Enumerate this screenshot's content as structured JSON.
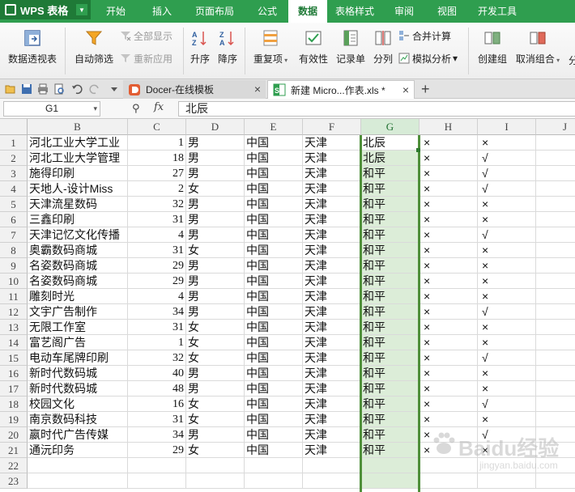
{
  "app": {
    "title": "WPS 表格"
  },
  "menu_tabs": [
    {
      "label": "开始",
      "active": false
    },
    {
      "label": "插入",
      "active": false
    },
    {
      "label": "页面布局",
      "active": false
    },
    {
      "label": "公式",
      "active": false
    },
    {
      "label": "数据",
      "active": true
    },
    {
      "label": "表格样式",
      "active": false
    },
    {
      "label": "审阅",
      "active": false
    },
    {
      "label": "视图",
      "active": false
    },
    {
      "label": "开发工具",
      "active": false
    }
  ],
  "ribbon": {
    "pivot": "数据透视表",
    "autofilter": "自动筛选",
    "show_all": "全部显示",
    "reapply": "重新应用",
    "sort_asc": "升序",
    "sort_desc": "降序",
    "duplicates": "重复项",
    "validity": "有效性",
    "record_form": "记录单",
    "split_column": "分列",
    "consolidate": "合并计算",
    "whatif": "模拟分析",
    "group": "创建组",
    "ungroup": "取消组合",
    "subtotal_partial": "分"
  },
  "doc_tabs": [
    {
      "label": "Docer-在线模板",
      "active": false
    },
    {
      "label": "新建 Micro...作表.xls *",
      "active": true
    }
  ],
  "formula_bar": {
    "name_box": "G1",
    "fx": "fx",
    "content": "北辰"
  },
  "columns": [
    "B",
    "C",
    "D",
    "E",
    "F",
    "G",
    "H",
    "I",
    "J"
  ],
  "selected_column": "G",
  "rows": [
    {
      "n": "1",
      "b": "河北工业大学工业",
      "c": "1",
      "d": "男",
      "e": "中国",
      "f": "天津",
      "g": "北辰",
      "h": "×",
      "i": "×"
    },
    {
      "n": "2",
      "b": "河北工业大学管理",
      "c": "18",
      "d": "男",
      "e": "中国",
      "f": "天津",
      "g": "北辰",
      "h": "×",
      "i": "√"
    },
    {
      "n": "3",
      "b": "施得印刷",
      "c": "27",
      "d": "男",
      "e": "中国",
      "f": "天津",
      "g": "和平",
      "h": "×",
      "i": "√"
    },
    {
      "n": "4",
      "b": "天地人-设计Miss",
      "c": "2",
      "d": "女",
      "e": "中国",
      "f": "天津",
      "g": "和平",
      "h": "×",
      "i": "√"
    },
    {
      "n": "5",
      "b": "天津流星数码",
      "c": "32",
      "d": "男",
      "e": "中国",
      "f": "天津",
      "g": "和平",
      "h": "×",
      "i": "×"
    },
    {
      "n": "6",
      "b": "三鑫印刷",
      "c": "31",
      "d": "男",
      "e": "中国",
      "f": "天津",
      "g": "和平",
      "h": "×",
      "i": "×"
    },
    {
      "n": "7",
      "b": "天津记忆文化传播",
      "c": "4",
      "d": "男",
      "e": "中国",
      "f": "天津",
      "g": "和平",
      "h": "×",
      "i": "√"
    },
    {
      "n": "8",
      "b": "奥霸数码商城",
      "c": "31",
      "d": "女",
      "e": "中国",
      "f": "天津",
      "g": "和平",
      "h": "×",
      "i": "×"
    },
    {
      "n": "9",
      "b": "名姿数码商城",
      "c": "29",
      "d": "男",
      "e": "中国",
      "f": "天津",
      "g": "和平",
      "h": "×",
      "i": "×"
    },
    {
      "n": "10",
      "b": "名姿数码商城",
      "c": "29",
      "d": "男",
      "e": "中国",
      "f": "天津",
      "g": "和平",
      "h": "×",
      "i": "×"
    },
    {
      "n": "11",
      "b": "雕刻时光",
      "c": "4",
      "d": "男",
      "e": "中国",
      "f": "天津",
      "g": "和平",
      "h": "×",
      "i": "×"
    },
    {
      "n": "12",
      "b": "文宇广告制作",
      "c": "34",
      "d": "男",
      "e": "中国",
      "f": "天津",
      "g": "和平",
      "h": "×",
      "i": "√"
    },
    {
      "n": "13",
      "b": "无限工作室",
      "c": "31",
      "d": "女",
      "e": "中国",
      "f": "天津",
      "g": "和平",
      "h": "×",
      "i": "×"
    },
    {
      "n": "14",
      "b": "富艺阁广告",
      "c": "1",
      "d": "女",
      "e": "中国",
      "f": "天津",
      "g": "和平",
      "h": "×",
      "i": "×"
    },
    {
      "n": "15",
      "b": "电动车尾牌印刷",
      "c": "32",
      "d": "女",
      "e": "中国",
      "f": "天津",
      "g": "和平",
      "h": "×",
      "i": "√"
    },
    {
      "n": "16",
      "b": "新时代数码城",
      "c": "40",
      "d": "男",
      "e": "中国",
      "f": "天津",
      "g": "和平",
      "h": "×",
      "i": "×"
    },
    {
      "n": "17",
      "b": "新时代数码城",
      "c": "48",
      "d": "男",
      "e": "中国",
      "f": "天津",
      "g": "和平",
      "h": "×",
      "i": "×"
    },
    {
      "n": "18",
      "b": "校园文化",
      "c": "16",
      "d": "女",
      "e": "中国",
      "f": "天津",
      "g": "和平",
      "h": "×",
      "i": "√"
    },
    {
      "n": "19",
      "b": "南京数码科技",
      "c": "31",
      "d": "女",
      "e": "中国",
      "f": "天津",
      "g": "和平",
      "h": "×",
      "i": "×"
    },
    {
      "n": "20",
      "b": "嬴时代广告传媒",
      "c": "34",
      "d": "男",
      "e": "中国",
      "f": "天津",
      "g": "和平",
      "h": "×",
      "i": "√"
    },
    {
      "n": "21",
      "b": "通沅印务",
      "c": "29",
      "d": "女",
      "e": "中国",
      "f": "天津",
      "g": "和平",
      "h": "×",
      "i": "×"
    },
    {
      "n": "22",
      "b": "",
      "c": "",
      "d": "",
      "e": "",
      "f": "",
      "g": "",
      "h": "",
      "i": ""
    },
    {
      "n": "23",
      "b": "",
      "c": "",
      "d": "",
      "e": "",
      "f": "",
      "g": "",
      "h": "",
      "i": ""
    }
  ],
  "watermark": {
    "text": "Baidu经验",
    "sub": "jingyan.baidu.com"
  },
  "colors": {
    "menu_green": "#2f9e4f",
    "selection_green": "#dcedd8",
    "selection_border": "#4f8f3a"
  }
}
